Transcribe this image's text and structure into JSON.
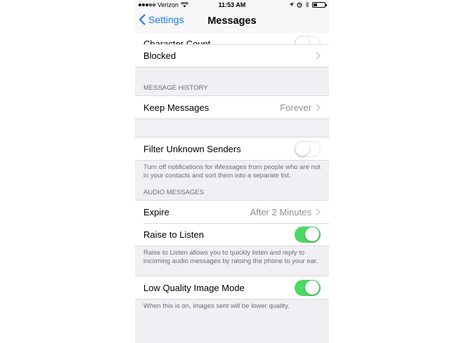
{
  "status_bar": {
    "carrier": "Verizon",
    "time": "11:53 AM",
    "signal_bars_filled": 3,
    "signal_bars_total": 5,
    "icons": [
      "wifi-icon",
      "location-icon",
      "alarm-icon",
      "bluetooth-icon",
      "battery-icon"
    ]
  },
  "nav": {
    "back_label": "Settings",
    "title": "Messages"
  },
  "partial_row": {
    "label": "Character Count",
    "toggle_on": false
  },
  "blocked": {
    "label": "Blocked"
  },
  "message_history": {
    "header": "MESSAGE HISTORY",
    "keep_messages": {
      "label": "Keep Messages",
      "value": "Forever"
    }
  },
  "filter": {
    "label": "Filter Unknown Senders",
    "toggle_on": false,
    "footer": "Turn off notifications for iMessages from people who are not in your contacts and sort them into a separate list."
  },
  "audio_messages": {
    "header": "AUDIO MESSAGES",
    "expire": {
      "label": "Expire",
      "value": "After 2 Minutes"
    },
    "raise_to_listen": {
      "label": "Raise to Listen",
      "toggle_on": true
    },
    "footer": "Raise to Listen allows you to quickly listen and reply to incoming audio messages by raising the phone to your ear."
  },
  "low_quality": {
    "label": "Low Quality Image Mode",
    "toggle_on": true,
    "footer": "When this is on, images sent will be lower quality."
  },
  "colors": {
    "accent": "#1a7cf5",
    "toggle_on": "#4cd964",
    "background": "#efeff4"
  }
}
